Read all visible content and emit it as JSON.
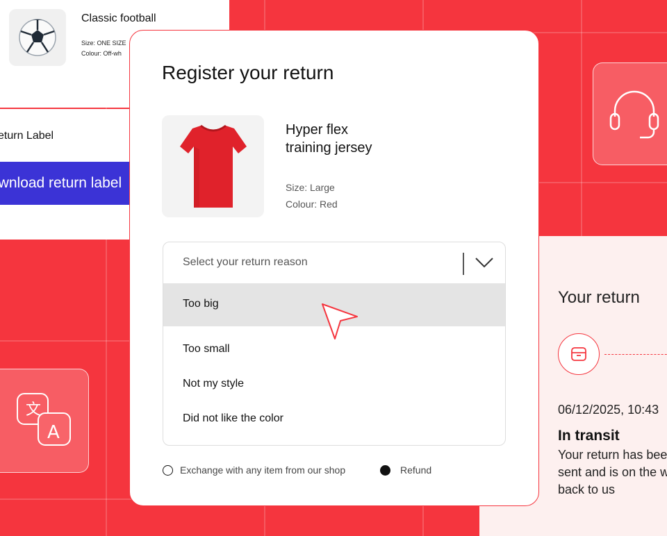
{
  "top_product": {
    "name": "Classic football",
    "size": "Size: ONE SIZE",
    "colour": "Colour: Off-wh"
  },
  "return_label": {
    "label": "eturn Label",
    "download_button": "ownload return label"
  },
  "modal": {
    "title": "Register your return",
    "product": {
      "name_line1": "Hyper flex",
      "name_line2": "training jersey",
      "size": "Size: Large",
      "colour": "Colour: Red"
    },
    "reason_select": {
      "placeholder": "Select your return reason",
      "options": [
        "Too big",
        "Too small",
        "Not my style",
        "Did not like the color"
      ],
      "highlighted": "Too big"
    },
    "resolution": {
      "exchange_label": "Exchange with any item from our shop",
      "refund_label": "Refund",
      "selected": "Refund"
    }
  },
  "tracking": {
    "heading": "Your return",
    "date": "06/12/2025, 10:43",
    "status": "In transit",
    "description": "Your return has been sent and is on the way back to us"
  },
  "icons": [
    "football-icon",
    "jersey-icon",
    "headset-icon",
    "translate-icon",
    "package-icon",
    "cursor-icon",
    "chevron-down-icon"
  ],
  "colors": {
    "brand_red": "#f5353e",
    "button_blue": "#3b33d6",
    "panel_tint": "#fdf0ef"
  }
}
